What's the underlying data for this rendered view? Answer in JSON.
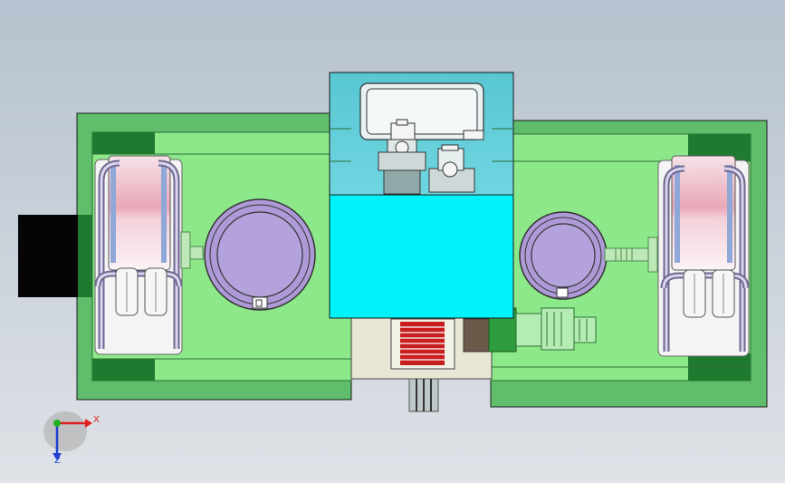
{
  "colors": {
    "bg_top": "#b6c2cf",
    "bg_bottom": "#dfe2e7",
    "plate_green": "#8de88a",
    "plate_dark": "#1e7a2e",
    "cyan_block": "#00f3f8",
    "cyan_top": "#4fc9d6",
    "disc_purple": "#ad9ad6",
    "roll_pink": "#f2c7d1",
    "rack_red": "#c81e1e",
    "motor_black": "#050505",
    "axis_x": "#e02020",
    "axis_y": "#20b020",
    "axis_z": "#2040d0"
  },
  "triad": {
    "x_label": "X",
    "z_label": "Z"
  },
  "icons": {
    "triad": "coordinate-triad-icon"
  }
}
